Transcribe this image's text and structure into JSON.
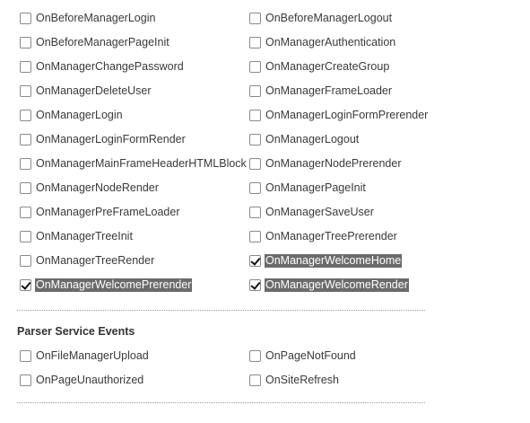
{
  "manager_events": [
    {
      "label": "OnBeforeManagerLogin",
      "checked": false
    },
    {
      "label": "OnBeforeManagerLogout",
      "checked": false
    },
    {
      "label": "OnBeforeManagerPageInit",
      "checked": false
    },
    {
      "label": "OnManagerAuthentication",
      "checked": false
    },
    {
      "label": "OnManagerChangePassword",
      "checked": false
    },
    {
      "label": "OnManagerCreateGroup",
      "checked": false
    },
    {
      "label": "OnManagerDeleteUser",
      "checked": false
    },
    {
      "label": "OnManagerFrameLoader",
      "checked": false
    },
    {
      "label": "OnManagerLogin",
      "checked": false
    },
    {
      "label": "OnManagerLoginFormPrerender",
      "checked": false
    },
    {
      "label": "OnManagerLoginFormRender",
      "checked": false
    },
    {
      "label": "OnManagerLogout",
      "checked": false
    },
    {
      "label": "OnManagerMainFrameHeaderHTMLBlock",
      "checked": false
    },
    {
      "label": "OnManagerNodePrerender",
      "checked": false
    },
    {
      "label": "OnManagerNodeRender",
      "checked": false
    },
    {
      "label": "OnManagerPageInit",
      "checked": false
    },
    {
      "label": "OnManagerPreFrameLoader",
      "checked": false
    },
    {
      "label": "OnManagerSaveUser",
      "checked": false
    },
    {
      "label": "OnManagerTreeInit",
      "checked": false
    },
    {
      "label": "OnManagerTreePrerender",
      "checked": false
    },
    {
      "label": "OnManagerTreeRender",
      "checked": false
    },
    {
      "label": "OnManagerWelcomeHome",
      "checked": true
    },
    {
      "label": "OnManagerWelcomePrerender",
      "checked": true
    },
    {
      "label": "OnManagerWelcomeRender",
      "checked": true
    }
  ],
  "parser_section": {
    "title": "Parser Service Events",
    "events": [
      {
        "label": "OnFileManagerUpload",
        "checked": false
      },
      {
        "label": "OnPageNotFound",
        "checked": false
      },
      {
        "label": "OnPageUnauthorized",
        "checked": false
      },
      {
        "label": "OnSiteRefresh",
        "checked": false
      }
    ]
  },
  "colors": {
    "selected_bg": "#6b6b6b",
    "selected_text": "#ffffff",
    "text": "#3a3a3a"
  }
}
